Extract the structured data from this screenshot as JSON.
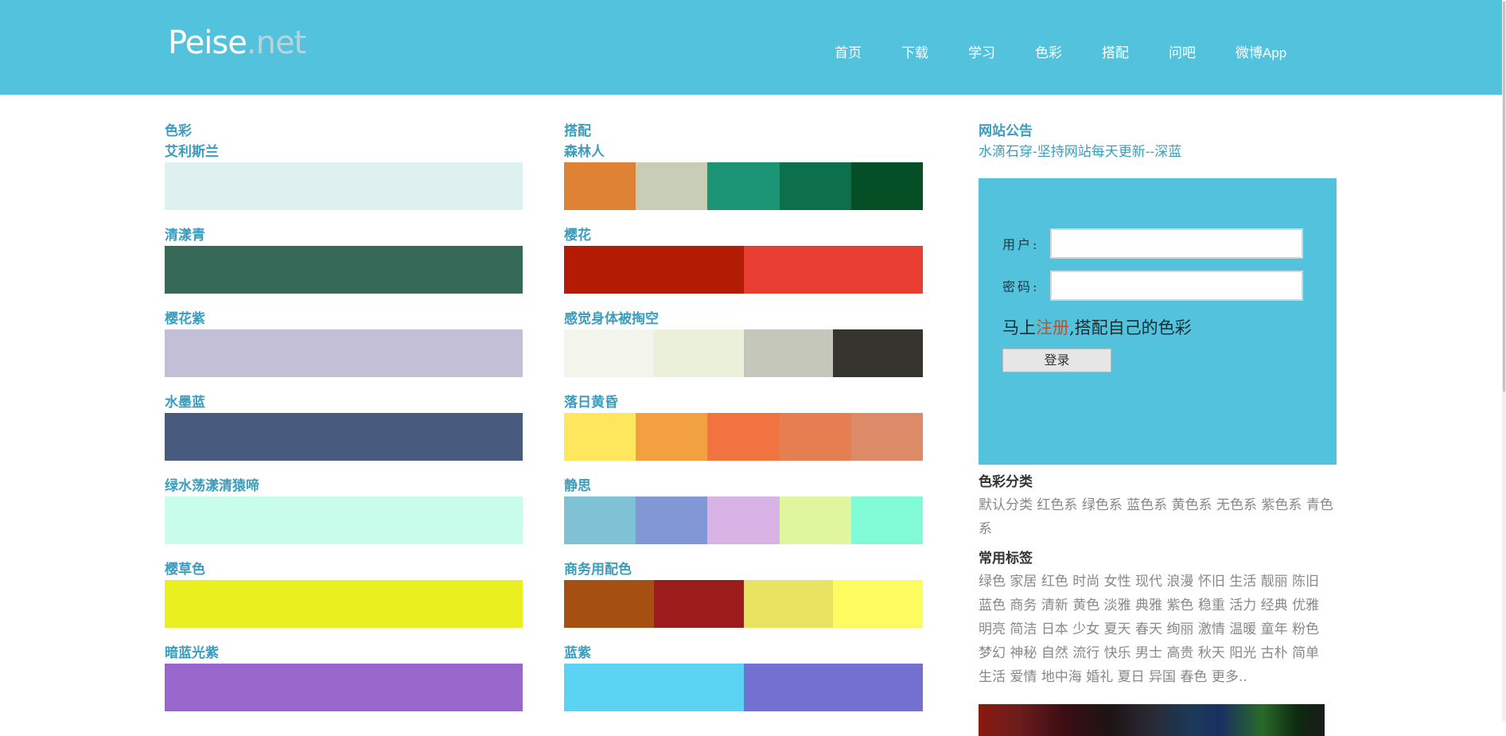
{
  "header": {
    "logo_main": "Peise",
    "logo_suffix": ".net",
    "nav": [
      "首页",
      "下载",
      "学习",
      "色彩",
      "搭配",
      "问吧",
      "微博App"
    ],
    "bg_color": "#52c2dd"
  },
  "colors_section": {
    "title": "色彩",
    "items": [
      {
        "name": "艾利斯兰",
        "color": "#dff0f0"
      },
      {
        "name": "清漾青",
        "color": "#376958"
      },
      {
        "name": "樱花紫",
        "color": "#c3bfd6"
      },
      {
        "name": "水墨蓝",
        "color": "#495a7f"
      },
      {
        "name": "绿水荡漾清猿啼",
        "color": "#c8fdeb"
      },
      {
        "name": "樱草色",
        "color": "#eaf01f"
      },
      {
        "name": "暗蓝光紫",
        "color": "#9966cc"
      }
    ]
  },
  "palettes_section": {
    "title": "搭配",
    "items": [
      {
        "name": "森林人",
        "colors": [
          "#df8236",
          "#c8cdb5",
          "#1a9474",
          "#0d704d",
          "#054f27"
        ]
      },
      {
        "name": "樱花",
        "colors": [
          "#b31b02",
          "#e83e32"
        ]
      },
      {
        "name": "感觉身体被掏空",
        "colors": [
          "#f3f4ec",
          "#ebf0db",
          "#c6c7bb",
          "#36342e"
        ]
      },
      {
        "name": "落日黄昏",
        "colors": [
          "#fee65d",
          "#f2a040",
          "#f17440",
          "#e57f52",
          "#dd8a68"
        ]
      },
      {
        "name": "静思",
        "colors": [
          "#7fc2d5",
          "#8298d6",
          "#d9b3e5",
          "#dff59e",
          "#81fbd5"
        ]
      },
      {
        "name": "商务用配色",
        "colors": [
          "#a54f12",
          "#9c1b1b",
          "#e8e261",
          "#fcfb60"
        ]
      },
      {
        "name": "蓝紫",
        "colors": [
          "#5bd4f3",
          "#7470d1"
        ]
      }
    ]
  },
  "sidebar": {
    "notice_title": "网站公告",
    "notice_text": "水滴石穿-坚持网站每天更新--深蓝",
    "login": {
      "user_label": "用户:",
      "pass_label": "密码:",
      "user_value": "",
      "pass_value": "",
      "register_prefix": "马上",
      "register_link": "注册",
      "register_suffix": ",搭配自己的色彩",
      "login_button": "登录"
    },
    "category_title": "色彩分类",
    "categories": [
      "默认分类",
      "红色系",
      "绿色系",
      "蓝色系",
      "黄色系",
      "无色系",
      "紫色系",
      "青色系"
    ],
    "tags_title": "常用标签",
    "tags": [
      "绿色",
      "家居",
      "红色",
      "时尚",
      "女性",
      "现代",
      "浪漫",
      "怀旧",
      "生活",
      "靓丽",
      "陈旧",
      "蓝色",
      "商务",
      "清新",
      "黄色",
      "淡雅",
      "典雅",
      "紫色",
      "稳重",
      "活力",
      "经典",
      "优雅",
      "明亮",
      "简洁",
      "日本",
      "少女",
      "夏天",
      "春天",
      "绚丽",
      "激情",
      "温暖",
      "童年",
      "粉色",
      "梦幻",
      "神秘",
      "自然",
      "流行",
      "快乐",
      "男士",
      "高贵",
      "秋天",
      "阳光",
      "古朴",
      "简单",
      "生活",
      "爱情",
      "地中海",
      "婚礼",
      "夏日",
      "异国",
      "春色",
      "更多.."
    ]
  }
}
